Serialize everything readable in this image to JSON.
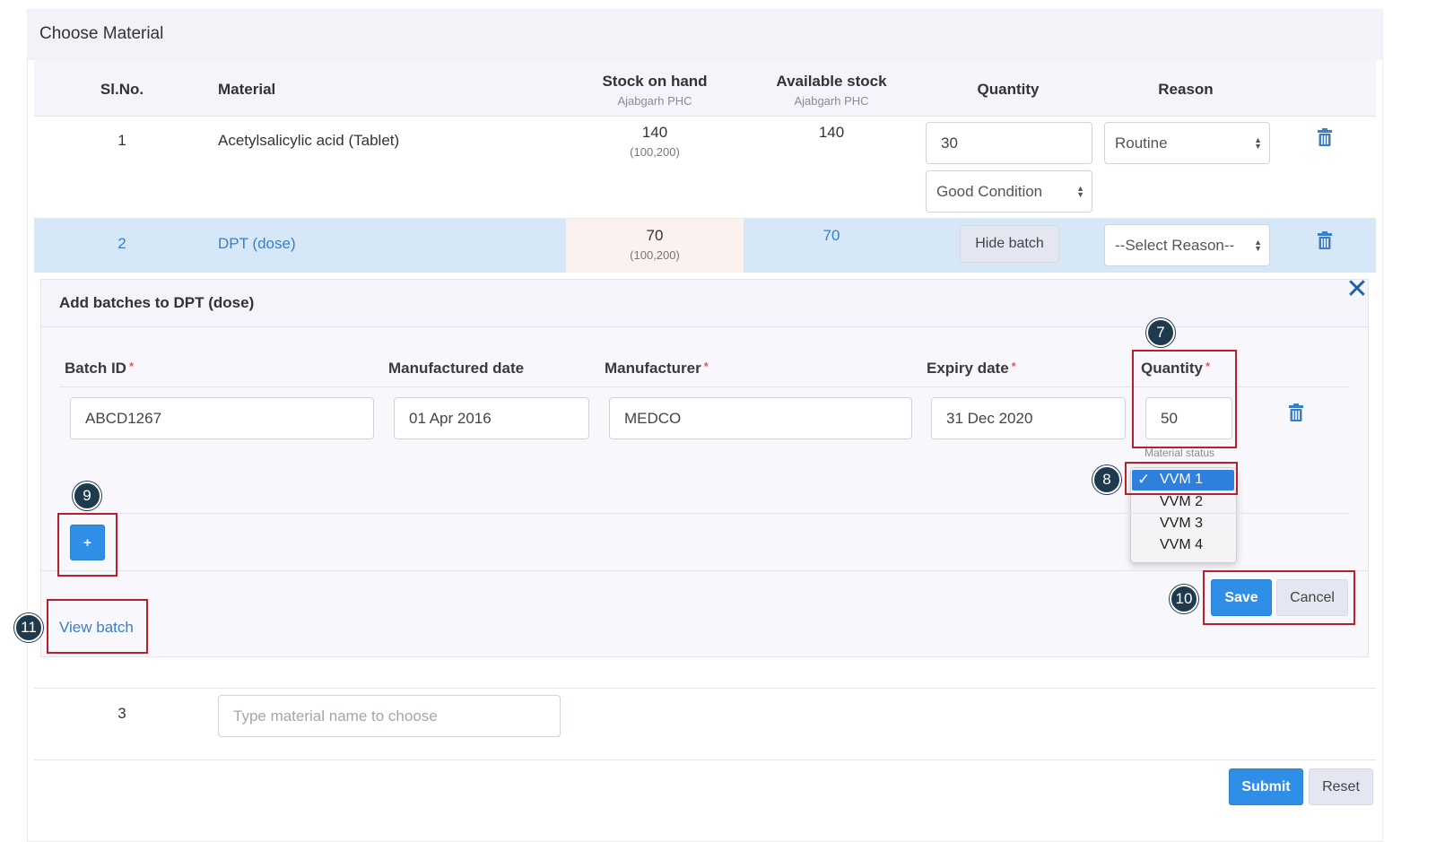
{
  "panel": {
    "title": "Choose Material"
  },
  "table": {
    "headers": {
      "slno": "Sl.No.",
      "material": "Material",
      "stock_on_hand": "Stock on hand",
      "stock_on_hand_sub": "Ajabgarh PHC",
      "available_stock": "Available stock",
      "available_stock_sub": "Ajabgarh PHC",
      "quantity": "Quantity",
      "reason": "Reason"
    },
    "rows": [
      {
        "slno": "1",
        "material": "Acetylsalicylic acid (Tablet)",
        "stock_on_hand": "140",
        "stock_range": "(100,200)",
        "available": "140",
        "quantity": "30",
        "condition": "Good Condition",
        "reason": "Routine"
      },
      {
        "slno": "2",
        "material": "DPT (dose)",
        "stock_on_hand": "70",
        "stock_range": "(100,200)",
        "available": "70",
        "hide_batch_label": "Hide batch",
        "reason": "--Select Reason--"
      },
      {
        "slno": "3",
        "material_placeholder": "Type material name to choose"
      }
    ]
  },
  "batch_panel": {
    "title": "Add batches to DPT (dose)",
    "close_icon": "close-icon",
    "headers": {
      "batch_id": "Batch ID",
      "manufactured_date": "Manufactured date",
      "manufacturer": "Manufacturer",
      "expiry_date": "Expiry date",
      "quantity": "Quantity",
      "required_mark": "*"
    },
    "row": {
      "batch_id": "ABCD1267",
      "manufactured_date": "01 Apr 2016",
      "manufacturer": "MEDCO",
      "expiry_date": "31 Dec 2020",
      "quantity": "50"
    },
    "material_status_label": "Material status",
    "material_status_options": [
      "VVM 1",
      "VVM 2",
      "VVM 3",
      "VVM 4"
    ],
    "material_status_selected": "VVM 1",
    "check_mark": "✓",
    "add_label": "+",
    "save_label": "Save",
    "cancel_label": "Cancel",
    "view_batch_label": "View batch"
  },
  "annotations": {
    "badge7": "7",
    "badge8": "8",
    "badge9": "9",
    "badge10": "10",
    "badge11": "11"
  },
  "footer": {
    "submit_label": "Submit",
    "reset_label": "Reset"
  },
  "colors": {
    "primary_button": "#2f8ee6",
    "highlight_row": "#d6e8f8",
    "annotation_border": "#b5202a",
    "badge": "#1f3a4c",
    "link": "#3a7fc4"
  }
}
